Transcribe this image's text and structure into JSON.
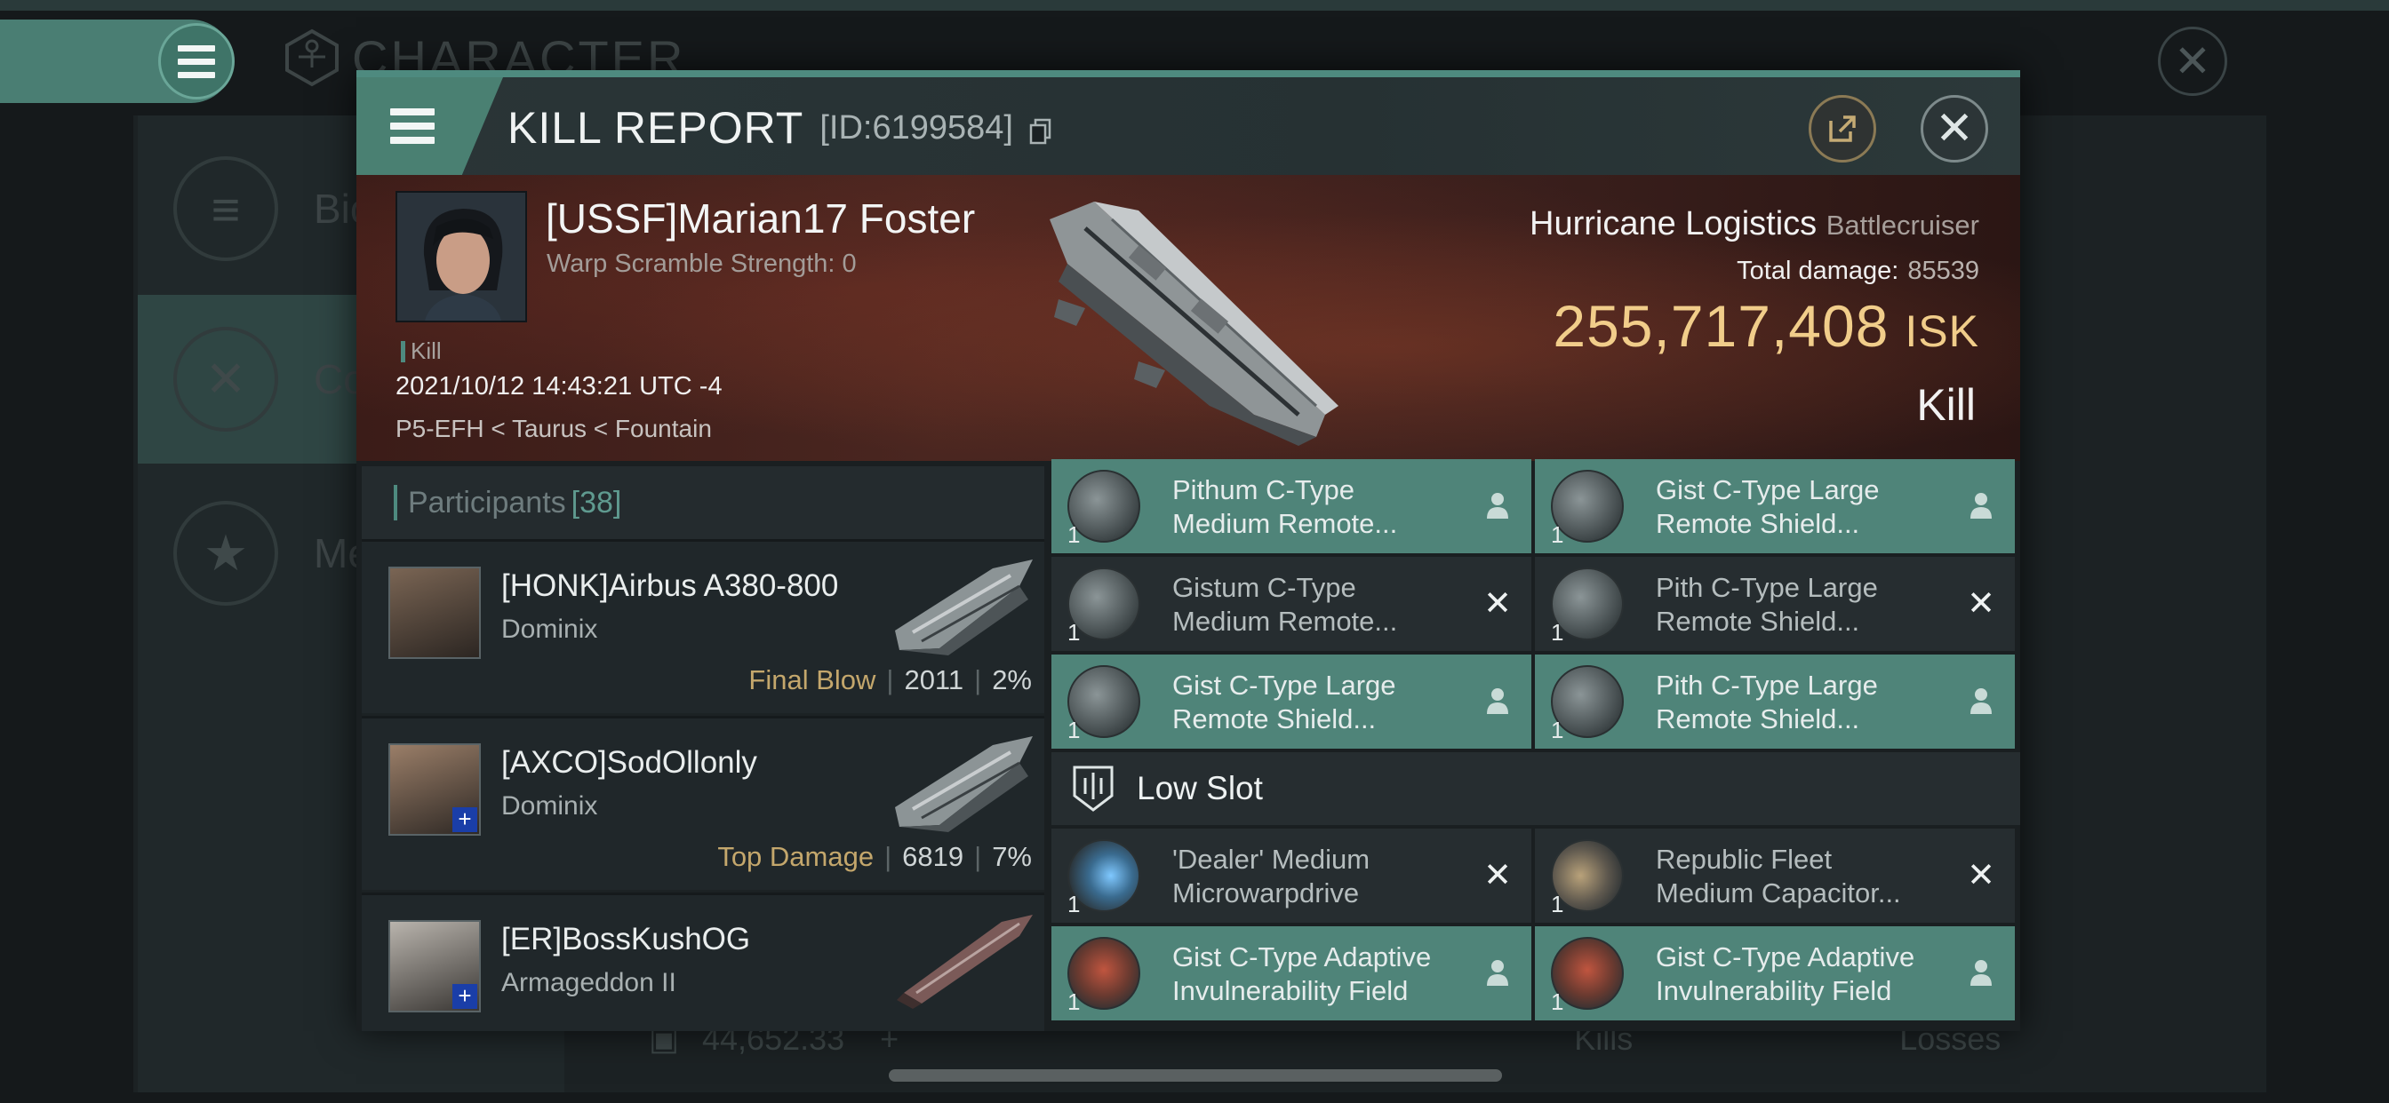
{
  "background": {
    "screen_title": "CHARACTER",
    "sidebar": [
      {
        "label": "Bio",
        "icon": "list-icon"
      },
      {
        "label": "Co",
        "icon": "crossed-swords-icon"
      },
      {
        "label": "Me",
        "icon": "star-badge-icon"
      }
    ],
    "wallet_value": "44,652.33",
    "legend": {
      "kills": "Kills",
      "losses": "Losses"
    }
  },
  "report": {
    "title": "KILL REPORT",
    "id_text": "[ID:6199584]",
    "victim": {
      "name": "[USSF]Marian17 Foster",
      "warp_scramble": "Warp Scramble Strength: 0",
      "kill_tag": "Kill",
      "datetime": "2021/10/12 14:43:21 UTC -4",
      "location": "P5-EFH < Taurus < Fountain"
    },
    "ship": {
      "name": "Hurricane Logistics",
      "class": "Battlecruiser",
      "total_damage_label": "Total damage:",
      "total_damage": "85539",
      "isk_value": "255,717,408",
      "isk_unit": "ISK",
      "result": "Kill"
    }
  },
  "participants": {
    "label": "Participants",
    "count": "[38]",
    "rows": [
      {
        "name": "[HONK]Airbus A380-800",
        "ship": "Dominix",
        "role": "Final Blow",
        "damage": "2011",
        "percent": "2%"
      },
      {
        "name": "[AXCO]SodOllonly",
        "ship": "Dominix",
        "role": "Top Damage",
        "damage": "6819",
        "percent": "7%"
      },
      {
        "name": "[ER]BossKushOG",
        "ship": "Armageddon II",
        "role": "",
        "damage": "",
        "percent": ""
      }
    ]
  },
  "modules": {
    "low_slot_label": "Low Slot",
    "mid": [
      {
        "name": "Pithum C-Type\nMedium Remote...",
        "qty": "1",
        "status": "fitted"
      },
      {
        "name": "Gist C-Type Large\nRemote Shield...",
        "qty": "1",
        "status": "fitted"
      },
      {
        "name": "Gistum C-Type\nMedium Remote...",
        "qty": "1",
        "status": "destroyed"
      },
      {
        "name": "Pith C-Type Large\nRemote Shield...",
        "qty": "1",
        "status": "destroyed"
      },
      {
        "name": "Gist C-Type Large\nRemote Shield...",
        "qty": "1",
        "status": "fitted"
      },
      {
        "name": "Pith C-Type Large\nRemote Shield...",
        "qty": "1",
        "status": "fitted"
      }
    ],
    "low": [
      {
        "name": "'Dealer' Medium\nMicrowarpdrive",
        "qty": "1",
        "status": "destroyed"
      },
      {
        "name": "Republic Fleet\nMedium Capacitor...",
        "qty": "1",
        "status": "destroyed"
      },
      {
        "name": "Gist C-Type Adaptive\nInvulnerability Field",
        "qty": "1",
        "status": "fitted"
      },
      {
        "name": "Gist C-Type Adaptive\nInvulnerability Field",
        "qty": "1",
        "status": "fitted"
      }
    ]
  },
  "colors": {
    "accent": "#4e8a7f",
    "isk": "#f1cd8a",
    "role": "#c4a76c"
  }
}
